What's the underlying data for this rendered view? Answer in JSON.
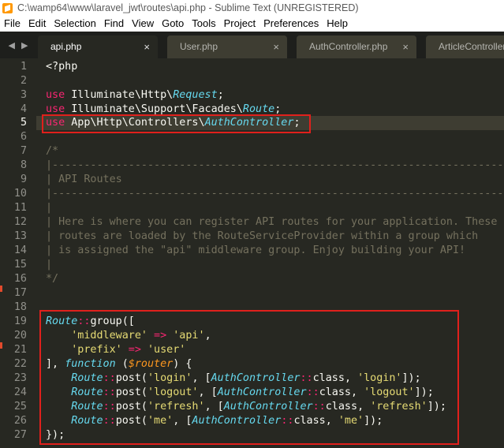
{
  "window": {
    "title": "C:\\wamp64\\www\\laravel_jwt\\routes\\api.php - Sublime Text (UNREGISTERED)"
  },
  "menu": [
    "File",
    "Edit",
    "Selection",
    "Find",
    "View",
    "Goto",
    "Tools",
    "Project",
    "Preferences",
    "Help"
  ],
  "tabs": [
    {
      "label": "api.php",
      "close": "×"
    },
    {
      "label": "User.php",
      "close": "×"
    },
    {
      "label": "AuthController.php",
      "close": "×"
    },
    {
      "label": "ArticleController.p"
    }
  ],
  "nav": {
    "left": "◀",
    "right": "▶"
  },
  "line_numbers": [
    "1",
    "2",
    "3",
    "4",
    "5",
    "6",
    "7",
    "8",
    "9",
    "10",
    "11",
    "12",
    "13",
    "14",
    "15",
    "16",
    "17",
    "18",
    "19",
    "20",
    "21",
    "22",
    "23",
    "24",
    "25",
    "26",
    "27"
  ],
  "current_line": 5,
  "code": {
    "l1": "<?php",
    "l3": {
      "kw": "use",
      "ns": " Illuminate\\Http\\",
      "cls": "Request",
      "end": ";"
    },
    "l4": {
      "kw": "use",
      "ns": " Illuminate\\Support\\Facades\\",
      "cls": "Route",
      "end": ";"
    },
    "l5": {
      "kw": "use",
      "ns": " App\\Http\\Controllers\\",
      "cls": "AuthController",
      "end": ";"
    },
    "l7": "/*",
    "l8": "|--------------------------------------------------------------------------",
    "l9": "| API Routes",
    "l10": "|--------------------------------------------------------------------------",
    "l11": "|",
    "l12": "| Here is where you can register API routes for your application. These",
    "l13": "| routes are loaded by the RouteServiceProvider within a group which",
    "l14": "| is assigned the \"api\" middleware group. Enjoy building your API!",
    "l15": "|",
    "l16": "*/",
    "l19": {
      "cls": "Route",
      "op": "::",
      "fn": "group(["
    },
    "l20": {
      "indent": "    ",
      "key": "'middleware'",
      "arrow": " => ",
      "val": "'api'",
      "end": ","
    },
    "l21": {
      "indent": "    ",
      "key": "'prefix'",
      "arrow": " => ",
      "val": "'user'"
    },
    "l22": {
      "start": "], ",
      "kw": "function",
      "open": " (",
      "arg": "$router",
      "close": ") {"
    },
    "routes": [
      {
        "path": "'login'",
        "action": "'login'"
      },
      {
        "path": "'logout'",
        "action": "'logout'"
      },
      {
        "path": "'refresh'",
        "action": "'refresh'"
      },
      {
        "path": "'me'",
        "action": "'me'"
      }
    ],
    "route_parts": {
      "indent": "    ",
      "cls": "Route",
      "op": "::",
      "post": "post(",
      "comma": ", [",
      "ctrl": "AuthController",
      "class_kw": "class",
      "sep": ", ",
      "close": "]);"
    },
    "l27": "});"
  }
}
